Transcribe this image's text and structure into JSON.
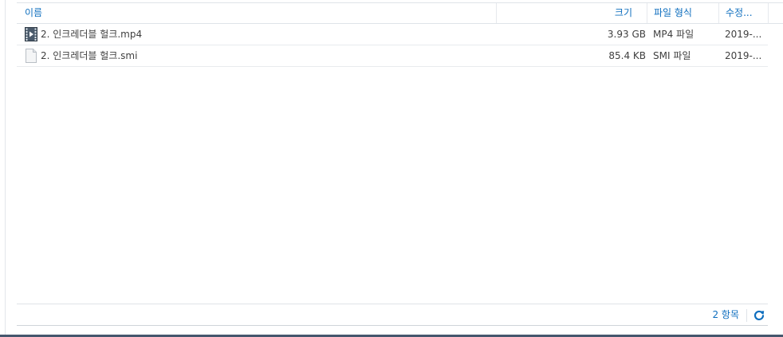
{
  "columns": {
    "name": "이름",
    "size": "크기",
    "type": "파일 형식",
    "modified": "수정..."
  },
  "files": [
    {
      "icon": "video-file-icon",
      "name": "2. 인크레더블 헐크.mp4",
      "size": "3.93 GB",
      "type": "MP4 파일",
      "modified": "2019-..."
    },
    {
      "icon": "document-file-icon",
      "name": "2. 인크레더블 헐크.smi",
      "size": "85.4 KB",
      "type": "SMI 파일",
      "modified": "2019-..."
    }
  ],
  "footer": {
    "count_label": "2 항목",
    "refresh_icon": "refresh-icon"
  },
  "colors": {
    "accent": "#0f6fbf",
    "text": "#404040",
    "border": "#dfe3e8"
  }
}
